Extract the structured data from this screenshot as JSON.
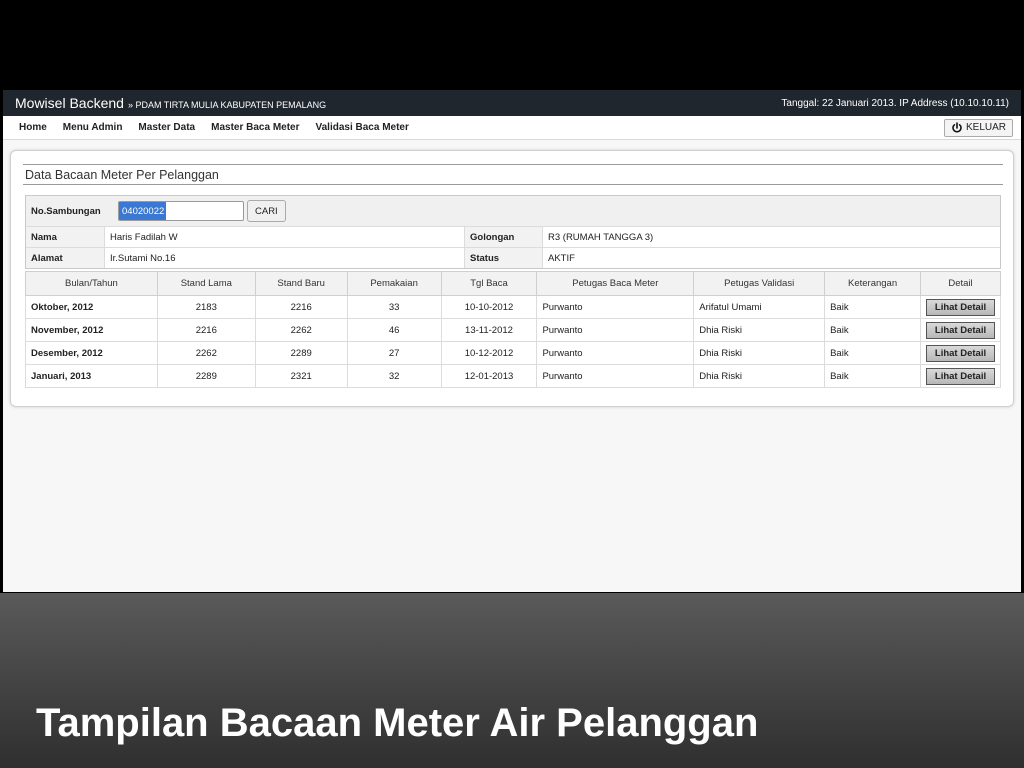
{
  "topbar": {
    "app_title": "Mowisel Backend",
    "breadcrumb": "» PDAM TIRTA MULIA KABUPATEN PEMALANG",
    "info": "Tanggal: 22 Januari 2013. IP Address (10.10.10.11)"
  },
  "menu": {
    "items": [
      "Home",
      "Menu Admin",
      "Master Data",
      "Master Baca Meter",
      "Validasi Baca Meter"
    ],
    "logout_label": "KELUAR"
  },
  "panel": {
    "title": "Data Bacaan Meter Per Pelanggan"
  },
  "customer": {
    "no_sambungan_label": "No.Sambungan",
    "no_sambungan_value": "04020022",
    "search_label": "CARI",
    "nama_label": "Nama",
    "nama_value": "Haris Fadilah W",
    "golongan_label": "Golongan",
    "golongan_value": "R3 (RUMAH TANGGA 3)",
    "alamat_label": "Alamat",
    "alamat_value": "Ir.Sutami No.16",
    "status_label": "Status",
    "status_value": "AKTIF"
  },
  "readings": {
    "headers": [
      "Bulan/Tahun",
      "Stand Lama",
      "Stand Baru",
      "Pemakaian",
      "Tgl Baca",
      "Petugas Baca Meter",
      "Petugas Validasi",
      "Keterangan",
      "Detail"
    ],
    "detail_label": "Lihat Detail",
    "rows": [
      {
        "month": "Oktober, 2012",
        "stand_lama": "2183",
        "stand_baru": "2216",
        "pemakaian": "33",
        "tgl_baca": "10-10-2012",
        "petugas_baca": "Purwanto",
        "petugas_validasi": "Arifatul Umami",
        "keterangan": "Baik"
      },
      {
        "month": "November, 2012",
        "stand_lama": "2216",
        "stand_baru": "2262",
        "pemakaian": "46",
        "tgl_baca": "13-11-2012",
        "petugas_baca": "Purwanto",
        "petugas_validasi": "Dhia Riski",
        "keterangan": "Baik"
      },
      {
        "month": "Desember, 2012",
        "stand_lama": "2262",
        "stand_baru": "2289",
        "pemakaian": "27",
        "tgl_baca": "10-12-2012",
        "petugas_baca": "Purwanto",
        "petugas_validasi": "Dhia Riski",
        "keterangan": "Baik"
      },
      {
        "month": "Januari, 2013",
        "stand_lama": "2289",
        "stand_baru": "2321",
        "pemakaian": "32",
        "tgl_baca": "12-01-2013",
        "petugas_baca": "Purwanto",
        "petugas_validasi": "Dhia Riski",
        "keterangan": "Baik"
      }
    ]
  },
  "slide": {
    "caption": "Tampilan Bacaan Meter Air Pelanggan"
  }
}
